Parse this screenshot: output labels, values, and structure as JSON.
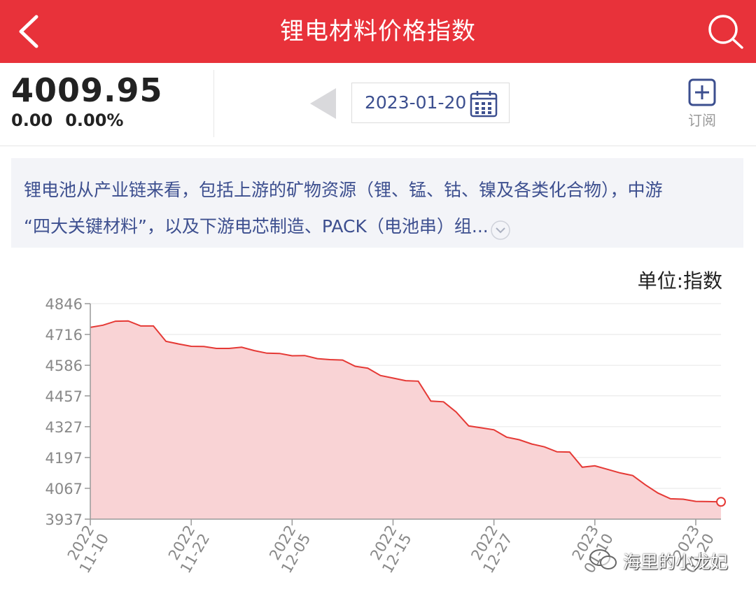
{
  "header": {
    "title": "锂电材料价格指数",
    "colors": {
      "background": "#e8323a",
      "text": "#ffffff"
    },
    "icons": {
      "back": "chevron-left-icon",
      "search": "search-icon"
    }
  },
  "quote": {
    "price": "4009.95",
    "change": "0.00",
    "change_pct": "0.00%"
  },
  "date_picker": {
    "date": "2023-01-20",
    "icons": {
      "prev": "triangle-left-icon",
      "calendar": "calendar-icon"
    }
  },
  "subscribe": {
    "label": "订阅",
    "icon": "plus-square-icon"
  },
  "description": {
    "line1": "锂电池从产业链来看，包括上游的矿物资源（锂、锰、钴、镍及各类化合物），中游",
    "line2": "“四大关键材料”，以及下游电芯制造、PACK（电池串）组...",
    "expand_icon": "chevron-down-icon"
  },
  "unit_label": "单位:指数",
  "watermark": {
    "text": "海里的小龙妃",
    "icon": "wechat-icon"
  },
  "chart_data": {
    "type": "area",
    "ylim": [
      3937,
      4846
    ],
    "yticks": [
      4846,
      4716,
      4586,
      4457,
      4327,
      4197,
      4067,
      3937
    ],
    "xticks": [
      {
        "index": 0,
        "line1": "2022",
        "line2": "11-10"
      },
      {
        "index": 8,
        "line1": "2022",
        "line2": "11-22"
      },
      {
        "index": 16,
        "line1": "2022",
        "line2": "12-05"
      },
      {
        "index": 24,
        "line1": "2022",
        "line2": "12-15"
      },
      {
        "index": 32,
        "line1": "2022",
        "line2": "12-27"
      },
      {
        "index": 40,
        "line1": "2023",
        "line2": "01-10"
      },
      {
        "index": 48,
        "line1": "2023",
        "line2": "01-20"
      }
    ],
    "values": [
      4746,
      4755,
      4772,
      4773,
      4752,
      4752,
      4687,
      4676,
      4666,
      4665,
      4657,
      4657,
      4662,
      4648,
      4637,
      4636,
      4626,
      4627,
      4614,
      4610,
      4608,
      4582,
      4574,
      4543,
      4532,
      4521,
      4519,
      4435,
      4432,
      4389,
      4330,
      4322,
      4314,
      4283,
      4272,
      4254,
      4242,
      4221,
      4220,
      4156,
      4162,
      4147,
      4132,
      4121,
      4082,
      4047,
      4023,
      4021,
      4012,
      4011,
      4010
    ],
    "colors": {
      "line": "#e53935",
      "fill": "#f9d3d5",
      "grid": "#e6e6e6",
      "axis": "#999999"
    },
    "grid": true
  }
}
